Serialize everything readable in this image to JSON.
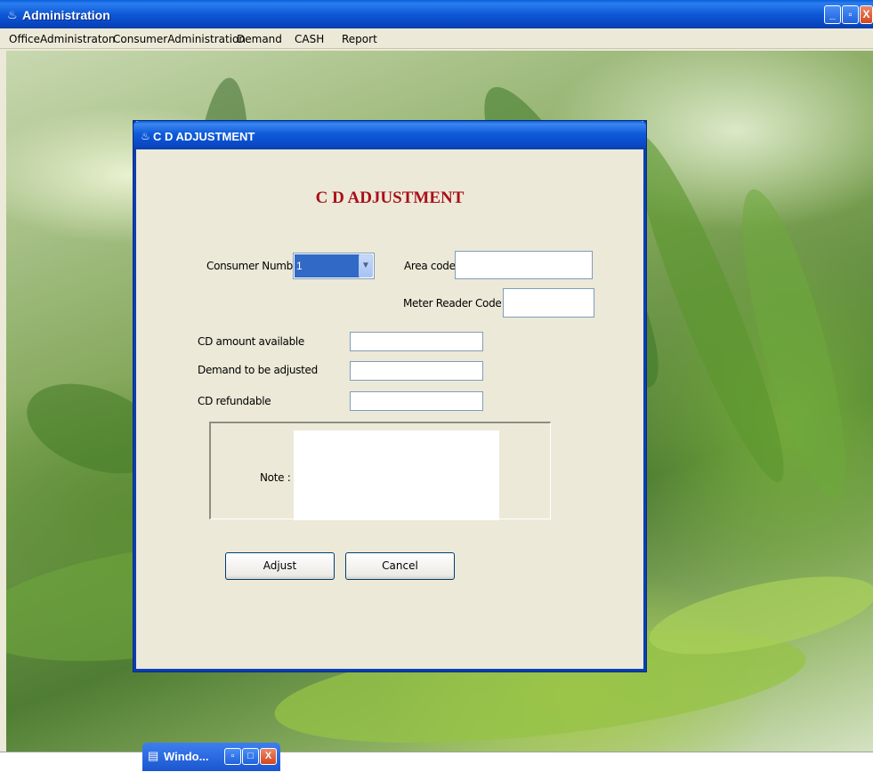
{
  "window": {
    "title": "Administration",
    "app_icon": "java-cup-icon",
    "controls": {
      "minimize": "_",
      "restore": "▫",
      "close": "X"
    }
  },
  "menubar": {
    "items": [
      {
        "label": "OfficeAdministraton"
      },
      {
        "label": "ConsumerAdministration"
      },
      {
        "label": "Demand"
      },
      {
        "label": "CASH"
      },
      {
        "label": "Report"
      }
    ]
  },
  "dialog": {
    "title": "C D ADJUSTMENT",
    "heading": "C D ADJUSTMENT",
    "consumer_number": {
      "label": "Consumer Number",
      "value": "1"
    },
    "area_code": {
      "label": "Area code",
      "value": ""
    },
    "meter_reader_code": {
      "label": "Meter Reader Code",
      "value": ""
    },
    "cd_amount_available": {
      "label": "CD amount available",
      "value": ""
    },
    "demand_to_adjust": {
      "label": "Demand to be adjusted",
      "value": ""
    },
    "cd_refundable": {
      "label": "CD refundable",
      "value": ""
    },
    "note": {
      "label": "Note :",
      "value": ""
    },
    "buttons": {
      "adjust": "Adjust",
      "cancel": "Cancel"
    }
  },
  "minimized_window": {
    "title": "Windo...",
    "icon": "window-icon"
  },
  "colors": {
    "titlebar": "#0a54d4",
    "heading": "#a8101a",
    "selection": "#3169c6",
    "dialog_bg": "#ece9d8"
  }
}
